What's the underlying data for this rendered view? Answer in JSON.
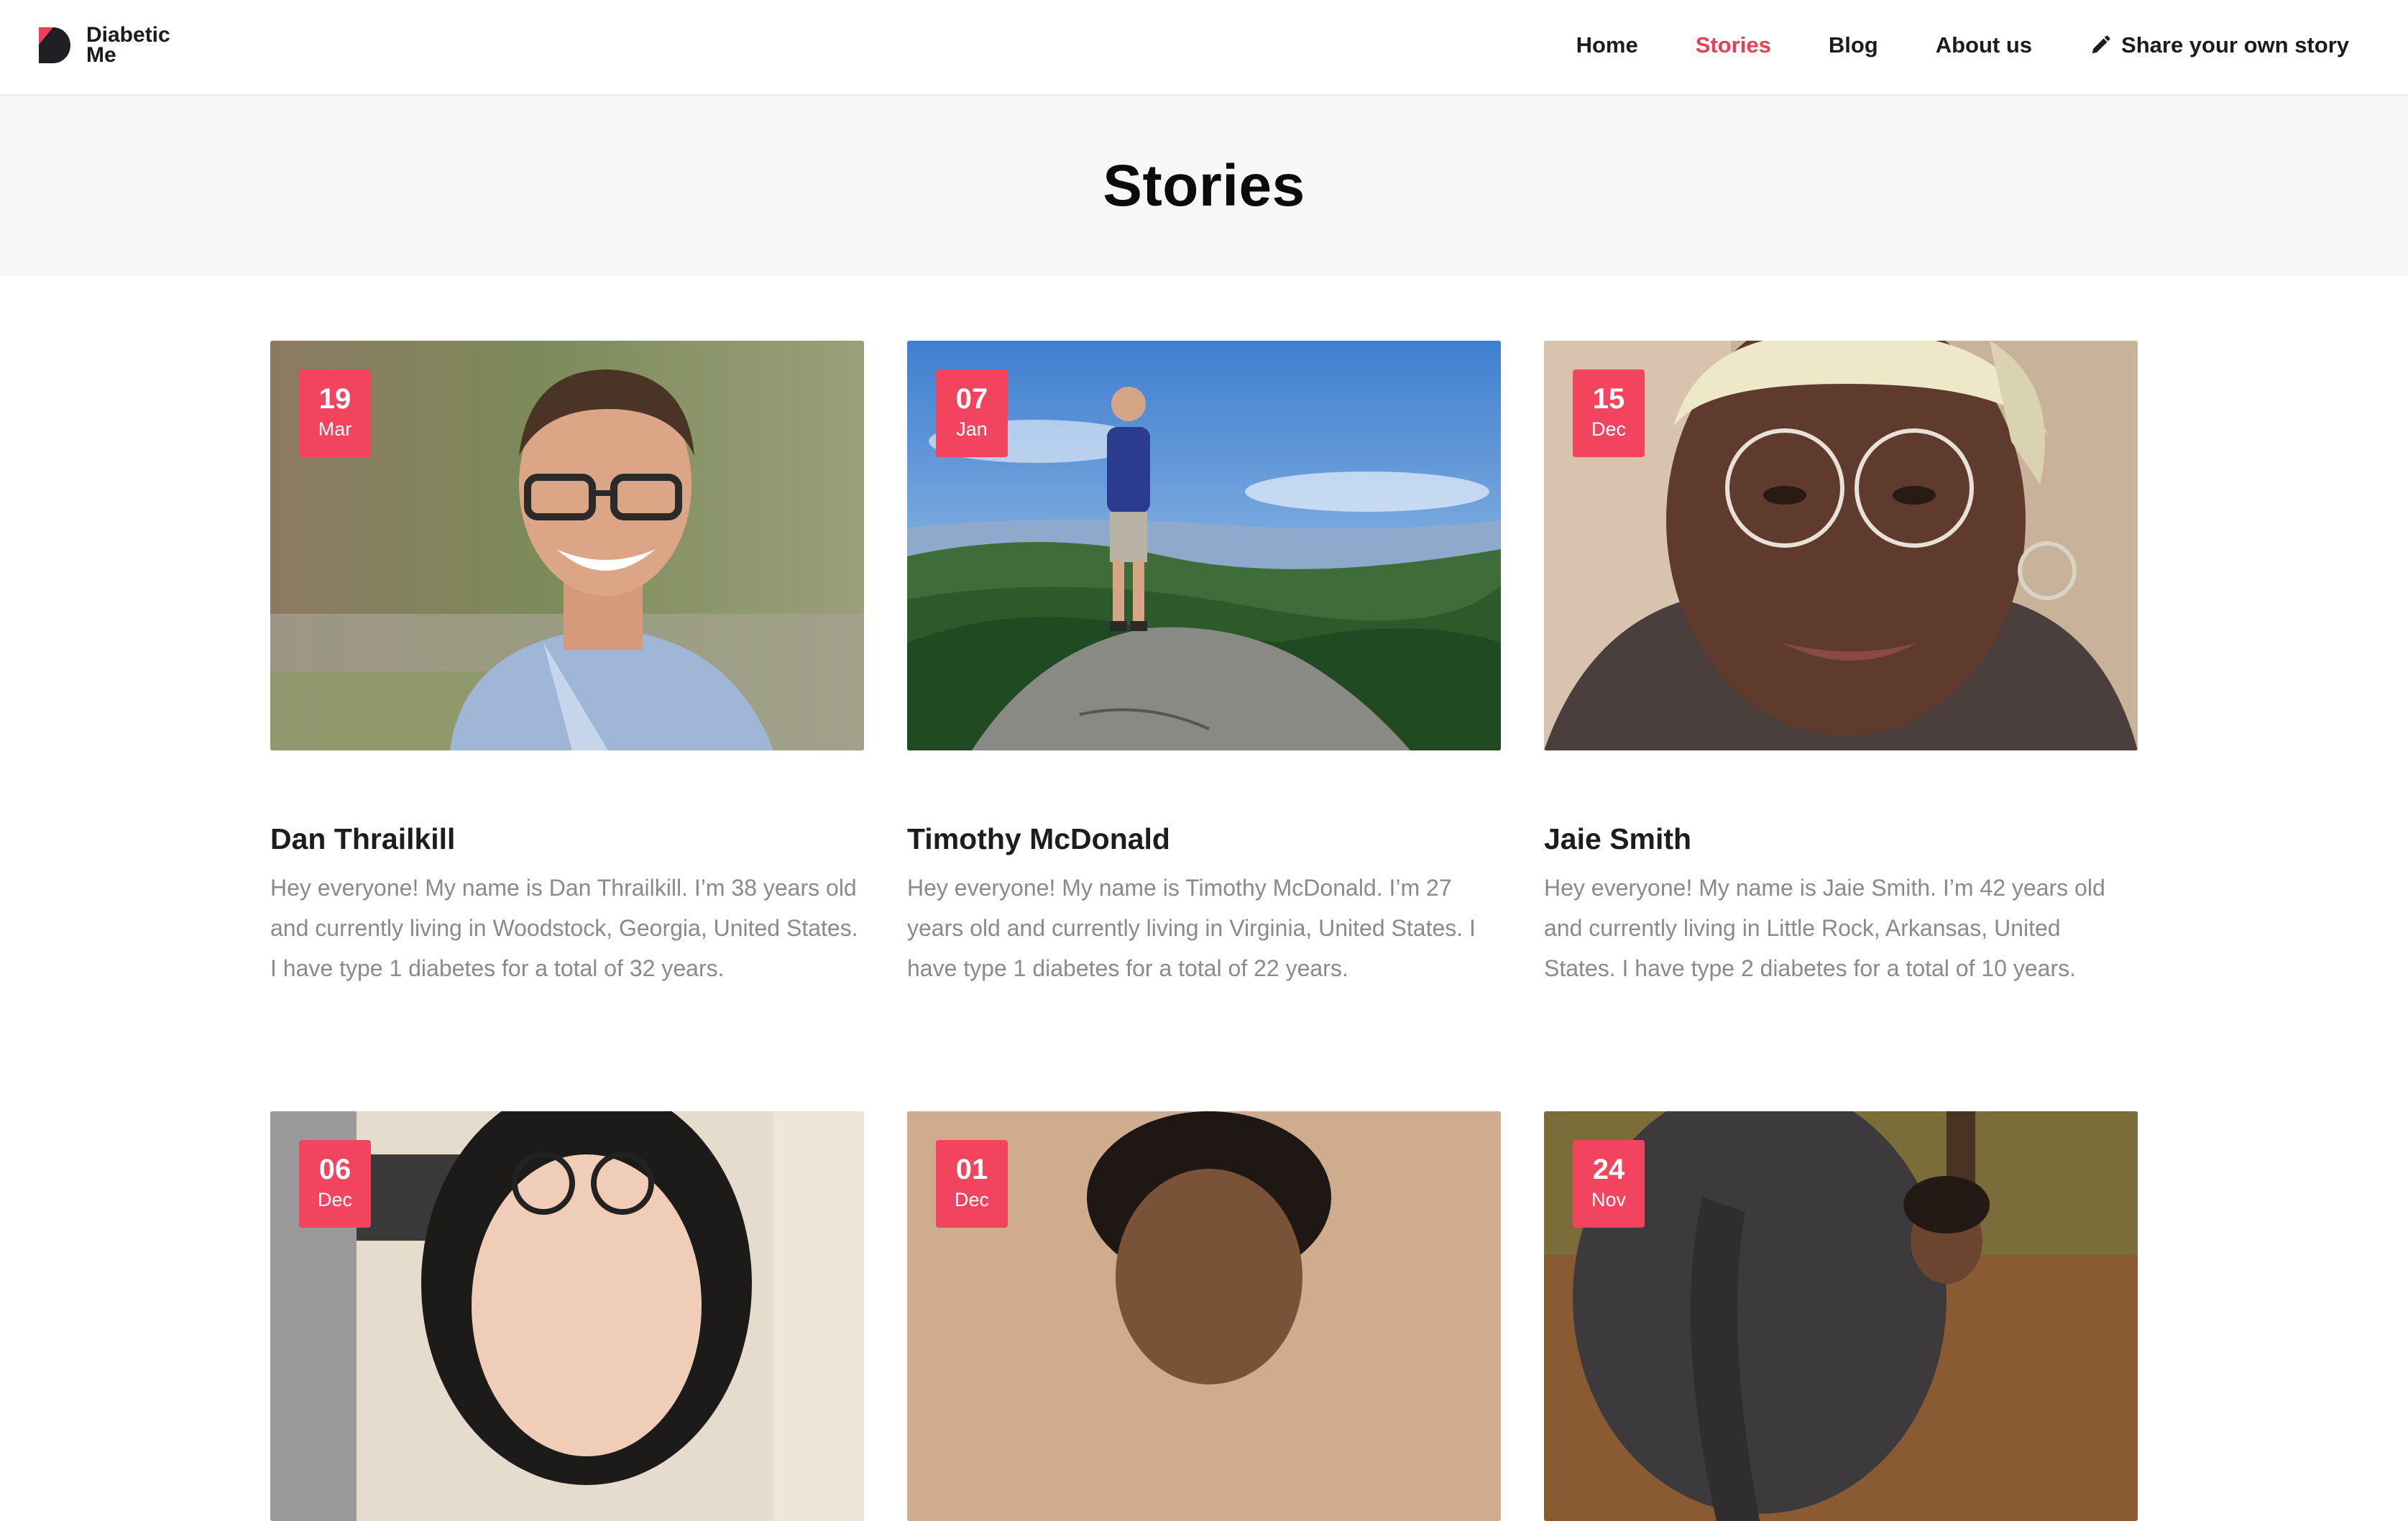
{
  "brand": {
    "line1": "Diabetic",
    "line2": "Me",
    "accent": "#ee3d57"
  },
  "nav": {
    "items": [
      {
        "label": "Home",
        "active": false
      },
      {
        "label": "Stories",
        "active": true
      },
      {
        "label": "Blog",
        "active": false
      },
      {
        "label": "About us",
        "active": false
      }
    ],
    "share": {
      "label": "Share your own story",
      "icon": "pencil-icon"
    }
  },
  "page": {
    "title": "Stories"
  },
  "stories": [
    {
      "day": "19",
      "month": "Mar",
      "name": "Dan Thrailkill",
      "excerpt": "Hey everyone! My name is Dan Thrailkill. I’m 38 years old and currently living in Woodstock, Georgia, United States. I have type 1 diabetes for a total of 32 years.",
      "photo": "portrait-photo"
    },
    {
      "day": "07",
      "month": "Jan",
      "name": "Timothy McDonald",
      "excerpt": "Hey everyone! My name is Timothy McDonald. I’m 27 years old and currently living in Virginia, United States. I have type 1 diabetes for a total of 22 years.",
      "photo": "mountain-photo"
    },
    {
      "day": "15",
      "month": "Dec",
      "name": "Jaie Smith",
      "excerpt": "Hey everyone! My name is Jaie Smith. I’m 42 years old and currently living in Little Rock, Arkansas, United States. I have type 2 diabetes for a total of 10 years.",
      "photo": "selfie-photo"
    },
    {
      "day": "06",
      "month": "Dec",
      "photo": "portrait-photo"
    },
    {
      "day": "01",
      "month": "Dec",
      "photo": "portrait-photo"
    },
    {
      "day": "24",
      "month": "Nov",
      "photo": "elephant-photo"
    }
  ],
  "colors": {
    "badge": "#f2445e",
    "title_band": "#f7f7f7",
    "excerpt_text": "#8a8a8a"
  }
}
